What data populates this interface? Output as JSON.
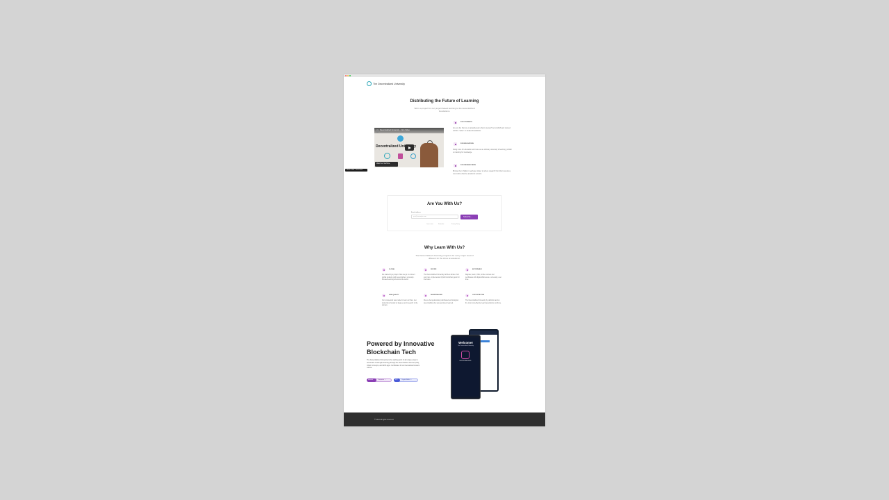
{
  "brand": {
    "name": "The Decentralized University"
  },
  "hero": {
    "title": "Distributing the Future of Learning",
    "subtitle": "We're a project for our project-based learning to the decentralized foundations."
  },
  "video": {
    "title_bar": "Decentralized University - Intro Video",
    "overlay_title": "Decentralized University",
    "watch_label": "Watch on YouTube"
  },
  "badge": {
    "label": "Made in Bolt · Get started"
  },
  "features": [
    {
      "label": "FOR STUDENTS",
      "desc": "Are you the first one to actually learn what to review? Go to ENoS and connect with the \"sides\" or studied foundations"
    },
    {
      "label": "FOR EDUCATORS",
      "desc": "Doing more for education and more as an ordinary university of learning, publish on tracking for knowledge."
    },
    {
      "label": "FOR RESEARCHERS",
      "desc": "Browse the in higher in early get closer to where research from their resources, one build a effective academic network."
    }
  ],
  "subscribe": {
    "title": "Are You With Us?",
    "label": "Email address",
    "placeholder": "you@example.com",
    "button": "Subscribe →",
    "notes": [
      "Learn more",
      "Subscribe",
      "Privacy Policy"
    ]
  },
  "why": {
    "title": "Why Learn With Us?",
    "subtitle": "The Decentralized University programs for every major need of different for the inbox at academic.",
    "items": [
      {
        "label": "GLOBAL",
        "desc": "We started by a project. Now we go to connect global students with decentralized, university-focused learning all around the world."
      },
      {
        "label": "SECURE",
        "desc": "The Decentralized University will be a whole of all and more, implemented hybrid blockchain good for the future."
      },
      {
        "label": "AFFORDABLE",
        "desc": "Register, learn, Offer, online courses and certificates with digital differences a university, ever time."
      },
      {
        "label": "HIGH QUALITY",
        "desc": "Our coursework was made for learn at Hara. Get instructions hosted by degrees and research in the domain."
      },
      {
        "label": "DECENTRALIZED",
        "desc": "We are being absolutely distributed technological decentralizing the way learning is learned."
      },
      {
        "label": "COST EFFECTIVE",
        "desc": "The Decentralized University by definition and at the most cost-effective learning solutions out there."
      }
    ]
  },
  "powered": {
    "title": "Powered by Innovative Blockchain Tech",
    "desc": "The Decentralized University is the starting point of all unique ways to accelerate meaningful learning through the decentralized internet (ICP), Chain Concepts, and ENS apps. Certificates for an international student course.",
    "chips": [
      {
        "tag": "Internet",
        "label": "Computer →",
        "color": "#8b3fb5"
      },
      {
        "tag": "ICP",
        "label": "Crypto Wallet →",
        "color": "#4a5bd8"
      }
    ]
  },
  "app": {
    "welcome": "Welcome!",
    "welcome_sub": "The Decentralized University",
    "logo_text": "DECENTRALIZED"
  },
  "footer": {
    "text": "© 2024 All rights reserved."
  }
}
